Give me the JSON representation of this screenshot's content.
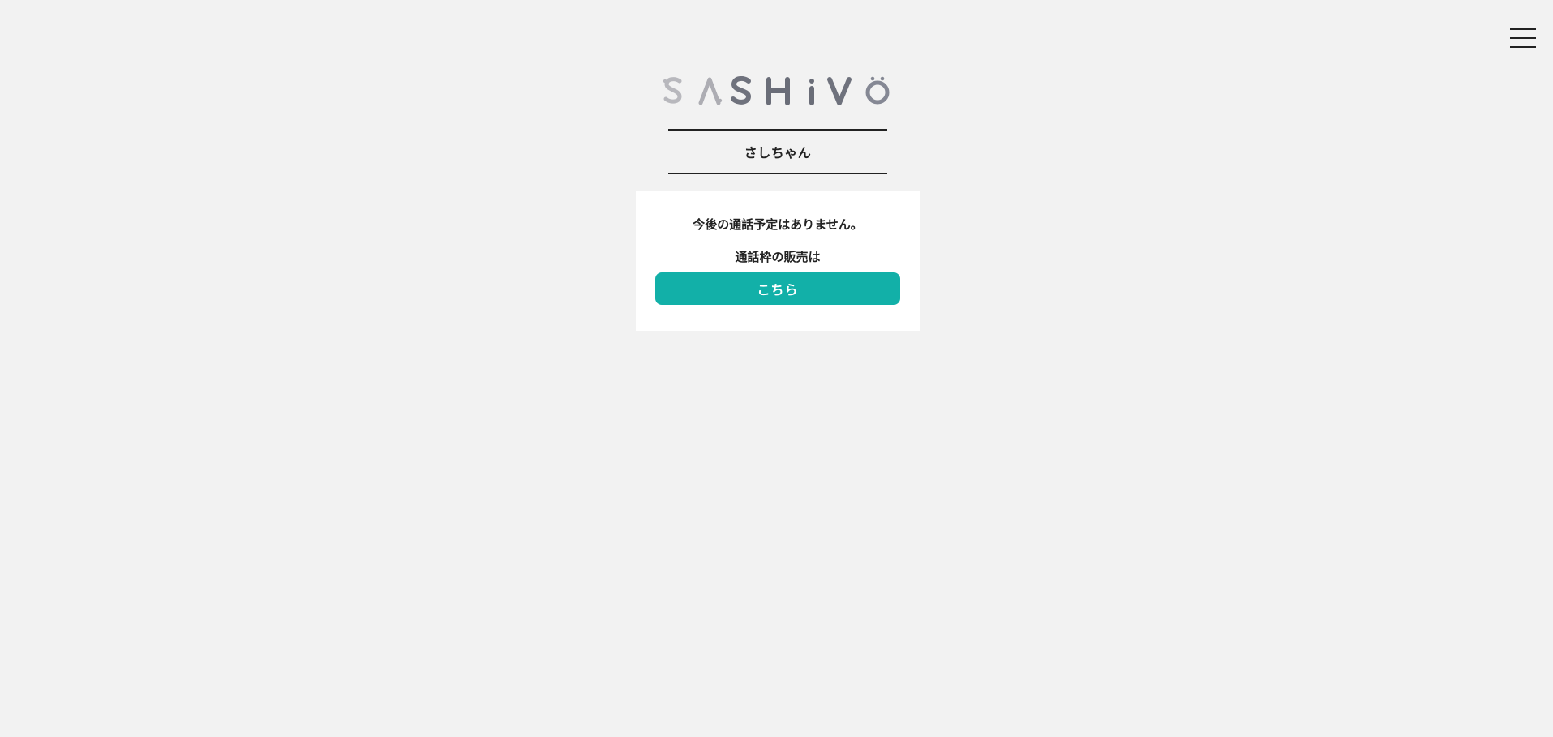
{
  "header": {
    "menu_icon": "hamburger-menu-icon",
    "logo_text": "SASHIVO"
  },
  "profile": {
    "name": "さしちゃん"
  },
  "schedule": {
    "empty_message": "今後の通話予定はありません。",
    "sale_prompt": "通話枠の販売は",
    "link_label": "こちら"
  },
  "colors": {
    "background": "#f2f2f2",
    "card": "#ffffff",
    "accent": "#12b0a8",
    "text": "#222222",
    "logo_light": "#b8b8bd",
    "logo_dark": "#6a6d78"
  }
}
